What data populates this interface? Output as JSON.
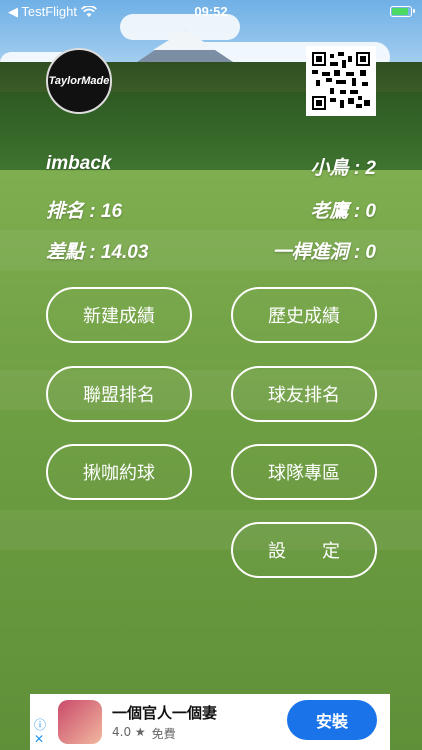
{
  "status_bar": {
    "back_label": "◀ TestFlight",
    "time": "09:52"
  },
  "header": {
    "logo_text": "TaylorMade"
  },
  "profile": {
    "name": "imback",
    "rank": "排名 : 16",
    "handicap": "差點 : 14.03",
    "birdie": "小鳥 : 2",
    "eagle": "老鷹 : 0",
    "hole_in_one": "一桿進洞 : 0"
  },
  "menu": {
    "new_score": "新建成績",
    "history_score": "歷史成績",
    "league_rank": "聯盟排名",
    "friend_rank": "球友排名",
    "invite_golf": "揪咖約球",
    "team_zone": "球隊專區",
    "settings": "設　　定"
  },
  "ad": {
    "title": "一個官人一個妻",
    "rating": "4.0 ★",
    "price": "免費",
    "install": "安裝",
    "info_icon": "ⓘ",
    "close_icon": "✕"
  },
  "colors": {
    "ad_button": "#1a73e8",
    "button_border": "#ffffff"
  }
}
